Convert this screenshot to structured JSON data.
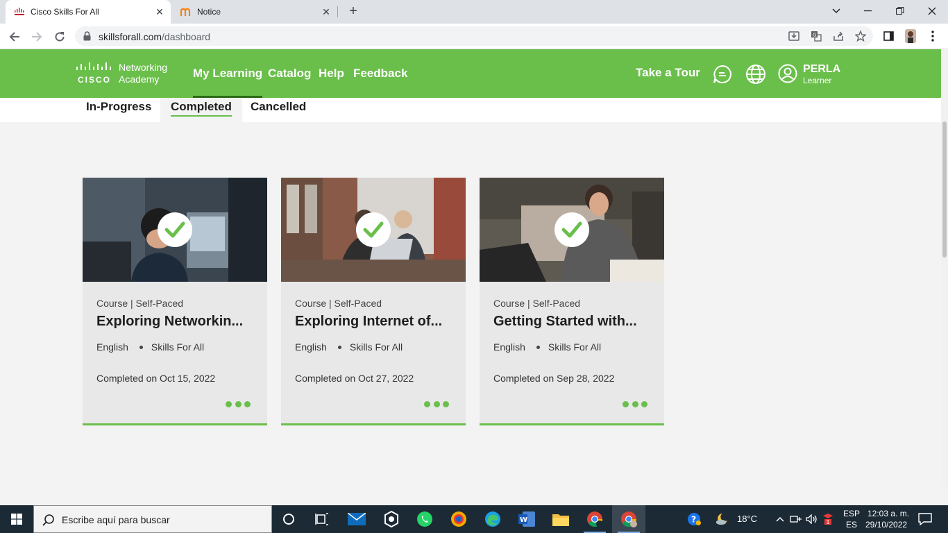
{
  "browser": {
    "tabs": [
      {
        "title": "Cisco Skills For All",
        "active": true
      },
      {
        "title": "Notice",
        "active": false
      }
    ],
    "url_host": "skillsforall.com",
    "url_path": "/dashboard"
  },
  "header": {
    "logo_line1": "Networking",
    "logo_line2": "Academy",
    "logo_brand": "CISCO",
    "nav": [
      {
        "label": "My Learning",
        "active": true
      },
      {
        "label": "Catalog"
      },
      {
        "label": "Help"
      },
      {
        "label": "Feedback"
      }
    ],
    "take_tour": "Take a Tour",
    "user_name": "PERLA",
    "user_role": "Learner"
  },
  "subtabs": [
    {
      "label": "In-Progress"
    },
    {
      "label": "Completed",
      "active": true
    },
    {
      "label": "Cancelled"
    }
  ],
  "cards": [
    {
      "meta": "Course | Self-Paced",
      "title": "Exploring Networkin...",
      "language": "English",
      "provider": "Skills For All",
      "completed": "Completed on Oct 15, 2022"
    },
    {
      "meta": "Course | Self-Paced",
      "title": "Exploring Internet of...",
      "language": "English",
      "provider": "Skills For All",
      "completed": "Completed on Oct 27, 2022"
    },
    {
      "meta": "Course | Self-Paced",
      "title": "Getting Started with...",
      "language": "English",
      "provider": "Skills For All",
      "completed": "Completed on Sep 28, 2022"
    }
  ],
  "taskbar": {
    "search_placeholder": "Escribe aquí para buscar",
    "temperature": "18°C",
    "lang_top": "ESP",
    "lang_bottom": "ES",
    "time": "12:03 a. m.",
    "date": "29/10/2022",
    "notification_count": "1"
  },
  "colors": {
    "brand_green": "#6abf4b",
    "active_nav_underline": "#2b6b16",
    "taskbar": "#1c2a35"
  }
}
